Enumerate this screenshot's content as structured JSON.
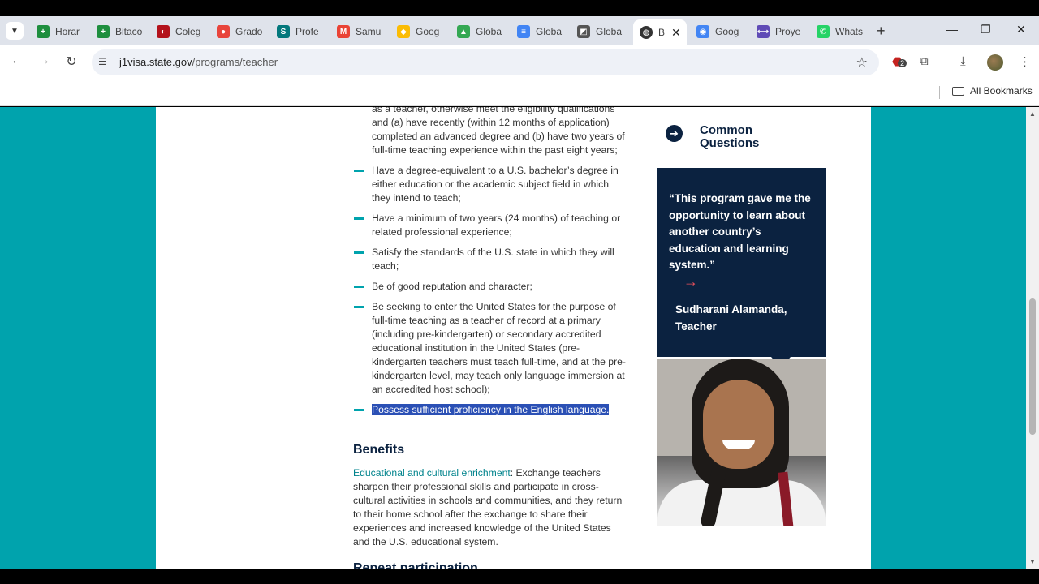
{
  "browser": {
    "tabs": [
      {
        "label": "Horar",
        "color": "#1e8e3e",
        "glyph": "+"
      },
      {
        "label": "Bitaco",
        "color": "#1e8e3e",
        "glyph": "+"
      },
      {
        "label": "Coleg",
        "color": "#b3121b",
        "glyph": "◐"
      },
      {
        "label": "Grado",
        "color": "#e8453c",
        "glyph": "●"
      },
      {
        "label": "Profe",
        "color": "#03787c",
        "glyph": "S"
      },
      {
        "label": "Samu",
        "color": "#ea4335",
        "glyph": "M"
      },
      {
        "label": "Goog",
        "color": "#fbbc04",
        "glyph": "◆"
      },
      {
        "label": "Globa",
        "color": "#34a853",
        "glyph": "▲"
      },
      {
        "label": "Globa",
        "color": "#4285f4",
        "glyph": "≡"
      },
      {
        "label": "Globa",
        "color": "#555555",
        "glyph": "◩"
      },
      {
        "label": "Goog",
        "color": "#4285f4",
        "glyph": "◉"
      },
      {
        "label": "Proye",
        "color": "#5f4bb6",
        "glyph": "⟷"
      },
      {
        "label": "Whats",
        "color": "#25d366",
        "glyph": "✆"
      }
    ],
    "active_tab": {
      "label": "B",
      "close": "✕"
    },
    "new_tab": "+",
    "window_controls": {
      "minimize": "—",
      "restore": "❐",
      "close": "✕"
    },
    "url_host": "j1visa.state.gov",
    "url_path": "/programs/teacher",
    "extension_badge": "2",
    "bookmarks_label": "All Bookmarks"
  },
  "page": {
    "intro_lines": [
      "as a teacher, otherwise meet the eligibility qualifications",
      "and (a) have recently (within 12 months of application)",
      "completed an advanced degree and (b) have two years of",
      "full-time teaching experience within the past eight years;"
    ],
    "bullets": [
      [
        "Have a degree-equivalent to a U.S. bachelor’s degree in",
        "either education or the academic subject field in which",
        "they intend to teach;"
      ],
      [
        "Have a minimum of two years (24 months) of teaching or",
        "related professional experience;"
      ],
      [
        "Satisfy the standards of the U.S. state in which they will",
        "teach;"
      ],
      [
        "Be of good reputation and character;"
      ],
      [
        "Be seeking to enter the United States for the purpose of",
        "full-time teaching as a teacher of record at a primary",
        "(including pre-kindergarten) or secondary accredited",
        "educational institution in the United States (pre-",
        "kindergarten teachers must teach full-time, and at the pre-",
        "kindergarten level, may teach only language immersion at",
        "an accredited host school);"
      ]
    ],
    "highlighted_bullet": "Possess sufficient proficiency in the English language.",
    "benefits_heading": "Benefits",
    "benefits_lead": "Educational and cultural enrichment",
    "benefits_lines": [
      ": Exchange teachers",
      "sharpen their professional skills and participate in cross-",
      "cultural activities in schools and communities, and they return",
      "to their home school after the exchange to share their",
      "experiences and increased knowledge of the United States",
      "and the U.S. educational system."
    ],
    "next_heading": "Repeat participation"
  },
  "sidebar": {
    "common_questions": "Common Questions",
    "quote": "“This program gave me the opportunity to learn about another country’s education and learning system.”",
    "quote_arrow": "→",
    "author": "Sudharani Alamanda, Teacher"
  }
}
